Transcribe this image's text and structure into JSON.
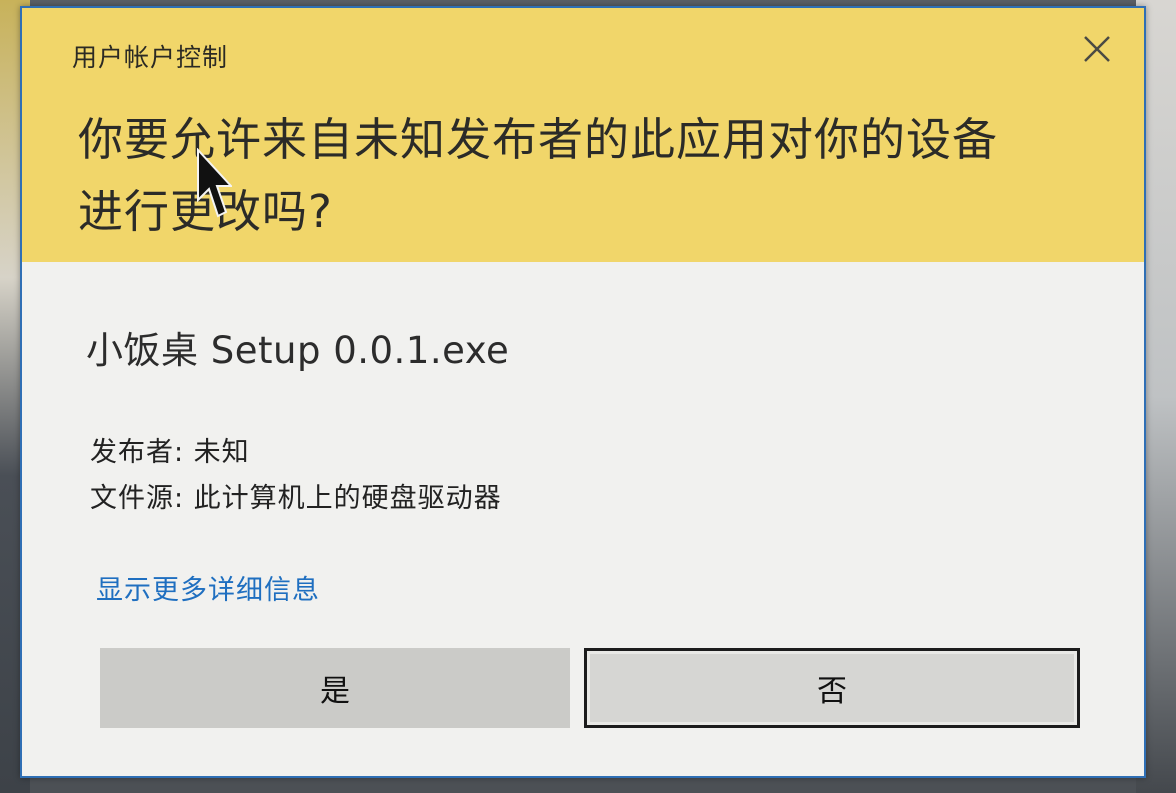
{
  "dialog": {
    "title": "用户帐户控制",
    "question_line1": "你要允许来自未知发布者的此应用对你的设备",
    "question_line2": "进行更改吗?",
    "app_name": "小饭桌 Setup 0.0.1.exe",
    "publisher": "发布者: 未知",
    "file_source": "文件源: 此计算机上的硬盘驱动器",
    "details_link": "显示更多详细信息",
    "yes_label": "是",
    "no_label": "否"
  },
  "icons": {
    "close": "close-icon",
    "cursor": "mouse-pointer-icon"
  },
  "colors": {
    "header": "#f1d66a",
    "body": "#f1f1ef",
    "link": "#1f6fc0",
    "border": "#2f6fb5",
    "button": "#cbcbc8"
  }
}
